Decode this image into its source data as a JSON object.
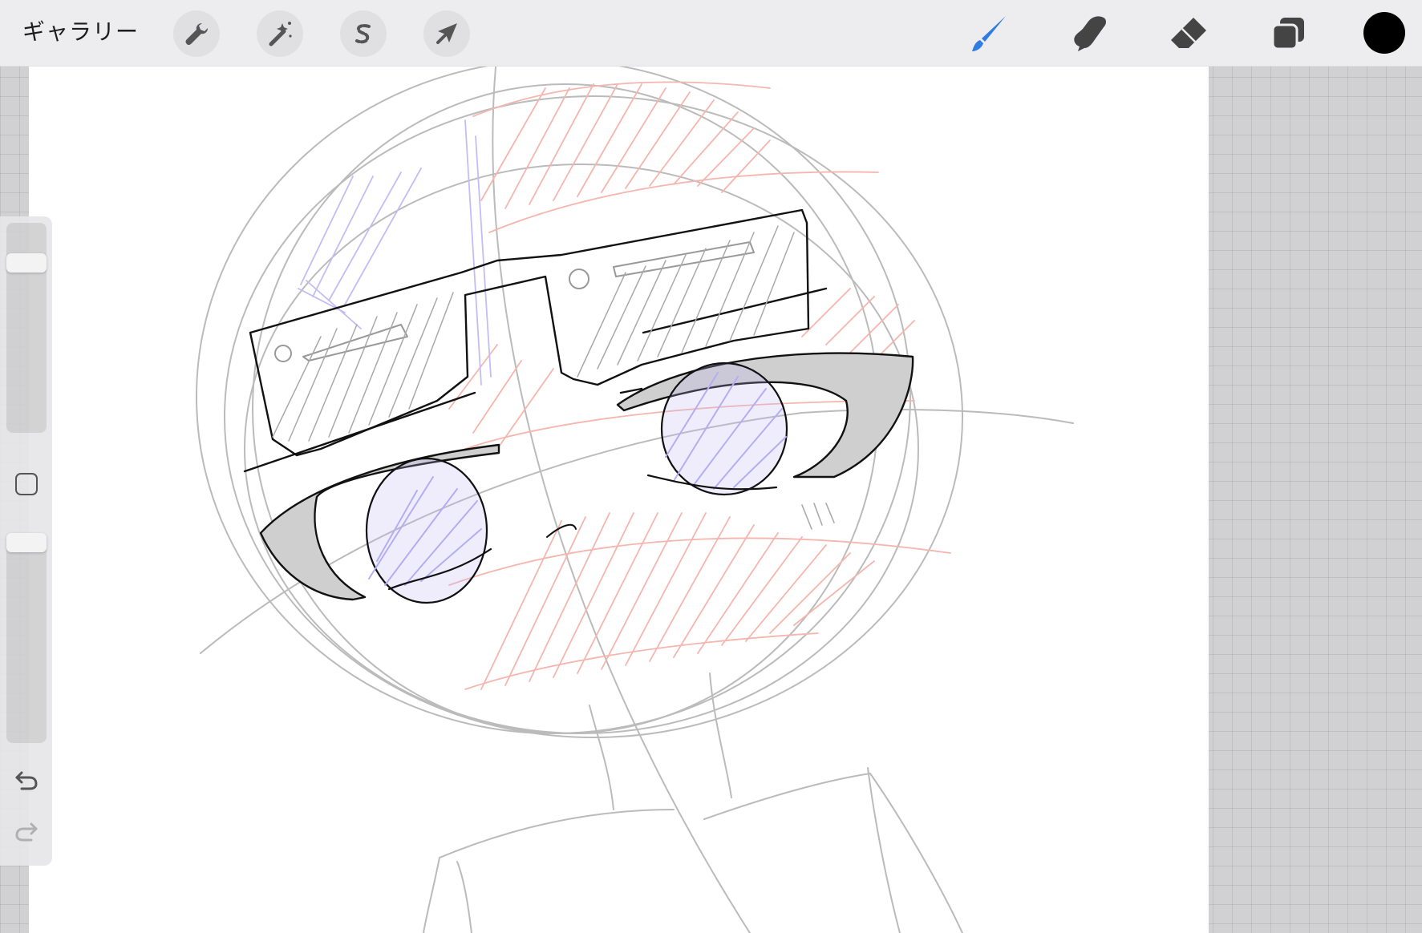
{
  "toolbar": {
    "gallery_label": "ギャラリー",
    "actions_icon": "wrench-icon",
    "adjustments_icon": "magic-wand-icon",
    "selection_icon": "s-selection-icon",
    "transform_icon": "arrow-cursor-icon",
    "brush_icon": "brush-icon",
    "smudge_icon": "smudge-finger-icon",
    "eraser_icon": "eraser-icon",
    "layers_icon": "layers-icon",
    "active_tool": "brush",
    "active_color": "#000000",
    "accent_color": "#2f7de1"
  },
  "sidebar": {
    "size_level": 0.84,
    "opacity_level": 1.0,
    "modify_icon": "square-modify-icon",
    "undo_icon": "undo-arrow-icon",
    "redo_icon": "redo-arrow-icon"
  },
  "canvas": {
    "background": "#ffffff",
    "sketch_colors": {
      "construction": "#b8b8b8",
      "red_hatching": "#f2b0a8",
      "blue_hatching": "#b4aef0",
      "ink": "#111111"
    }
  }
}
